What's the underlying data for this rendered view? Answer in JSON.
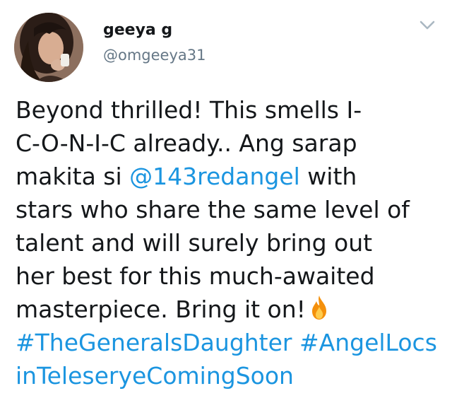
{
  "user": {
    "display_name": "geeya g",
    "handle": "@omgeeya31",
    "avatar_icon": "profile-photo"
  },
  "menu": {
    "icon": "chevron-down-icon"
  },
  "tweet": {
    "line1": "Beyond thrilled! This smells I-",
    "line2": "C-O-N-I-C already.. Ang sarap",
    "line3_before": "makita si ",
    "mention": "@143redangel",
    "line3_after": " with",
    "line4": "stars who share the same level of",
    "line5": "talent and will surely bring out",
    "line6": "her best for this much-awaited",
    "line7": "masterpiece. Bring it on!",
    "emoji": "fire-icon",
    "hashtag1": "#TheGeneralsDaughter",
    "hashtag2_part1": "#AngelLocs",
    "hashtag2_part2": "inTeleseryeComingSoon"
  },
  "colors": {
    "link": "#1b95e0",
    "text": "#14171a",
    "secondary": "#657786"
  }
}
